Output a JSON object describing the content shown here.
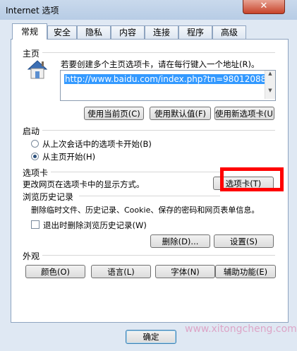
{
  "window": {
    "title": "Internet 选项",
    "close_label": "✕"
  },
  "tabs": [
    "常规",
    "安全",
    "隐私",
    "内容",
    "连接",
    "程序",
    "高级"
  ],
  "homepage": {
    "heading": "主页",
    "instruction": "若要创建多个主页选项卡，请在每行键入一个地址(R)。",
    "url": "http://www.baidu.com/index.php?tn=98012088",
    "use_current_label": "使用当前页(C)",
    "use_default_label": "使用默认值(F)",
    "use_new_tab_label": "使用新选项卡(U)"
  },
  "startup": {
    "heading": "启动",
    "option_last_session": "从上次会话中的选项卡开始(B)",
    "option_homepage": "从主页开始(H)",
    "selected": "从主页开始(H)"
  },
  "tabs_section": {
    "heading": "选项卡",
    "description": "更改网页在选项卡中的显示方式。",
    "button_label": "选项卡(T)"
  },
  "history": {
    "heading": "浏览历史记录",
    "description": "删除临时文件、历史记录、Cookie、保存的密码和网页表单信息。",
    "checkbox_label": "退出时删除浏览历史记录(W)",
    "checkbox_checked": false,
    "delete_label": "删除(D)...",
    "settings_label": "设置(S)"
  },
  "appearance": {
    "heading": "外观",
    "colors_label": "颜色(O)",
    "languages_label": "语言(L)",
    "fonts_label": "字体(N)",
    "accessibility_label": "辅助功能(E)"
  },
  "footer": {
    "ok_label": "确定",
    "watermark": "www.xitongcheng.com"
  }
}
